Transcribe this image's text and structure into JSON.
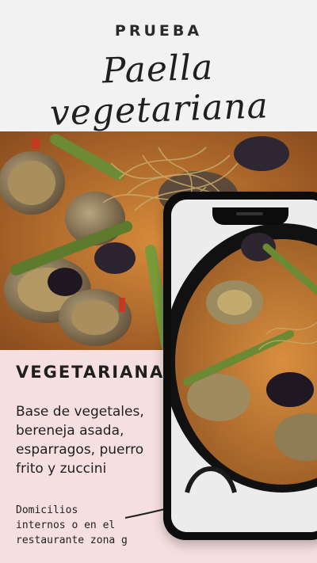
{
  "header": {
    "kicker": "PRUEBA",
    "title": "Paella vegetariana"
  },
  "card": {
    "title": "VEGETARIANA",
    "description": "Base de vegetales, bereneja asada, esparragos, puerro frito y zuccini",
    "delivery": "Domicilios\n internos o en el\nrestaurante zona g"
  },
  "colors": {
    "pink": "#f6dfe0",
    "header_bg": "#f2f2f2",
    "text": "#1f1f1f"
  },
  "icons": [
    "arrow-right-icon"
  ]
}
